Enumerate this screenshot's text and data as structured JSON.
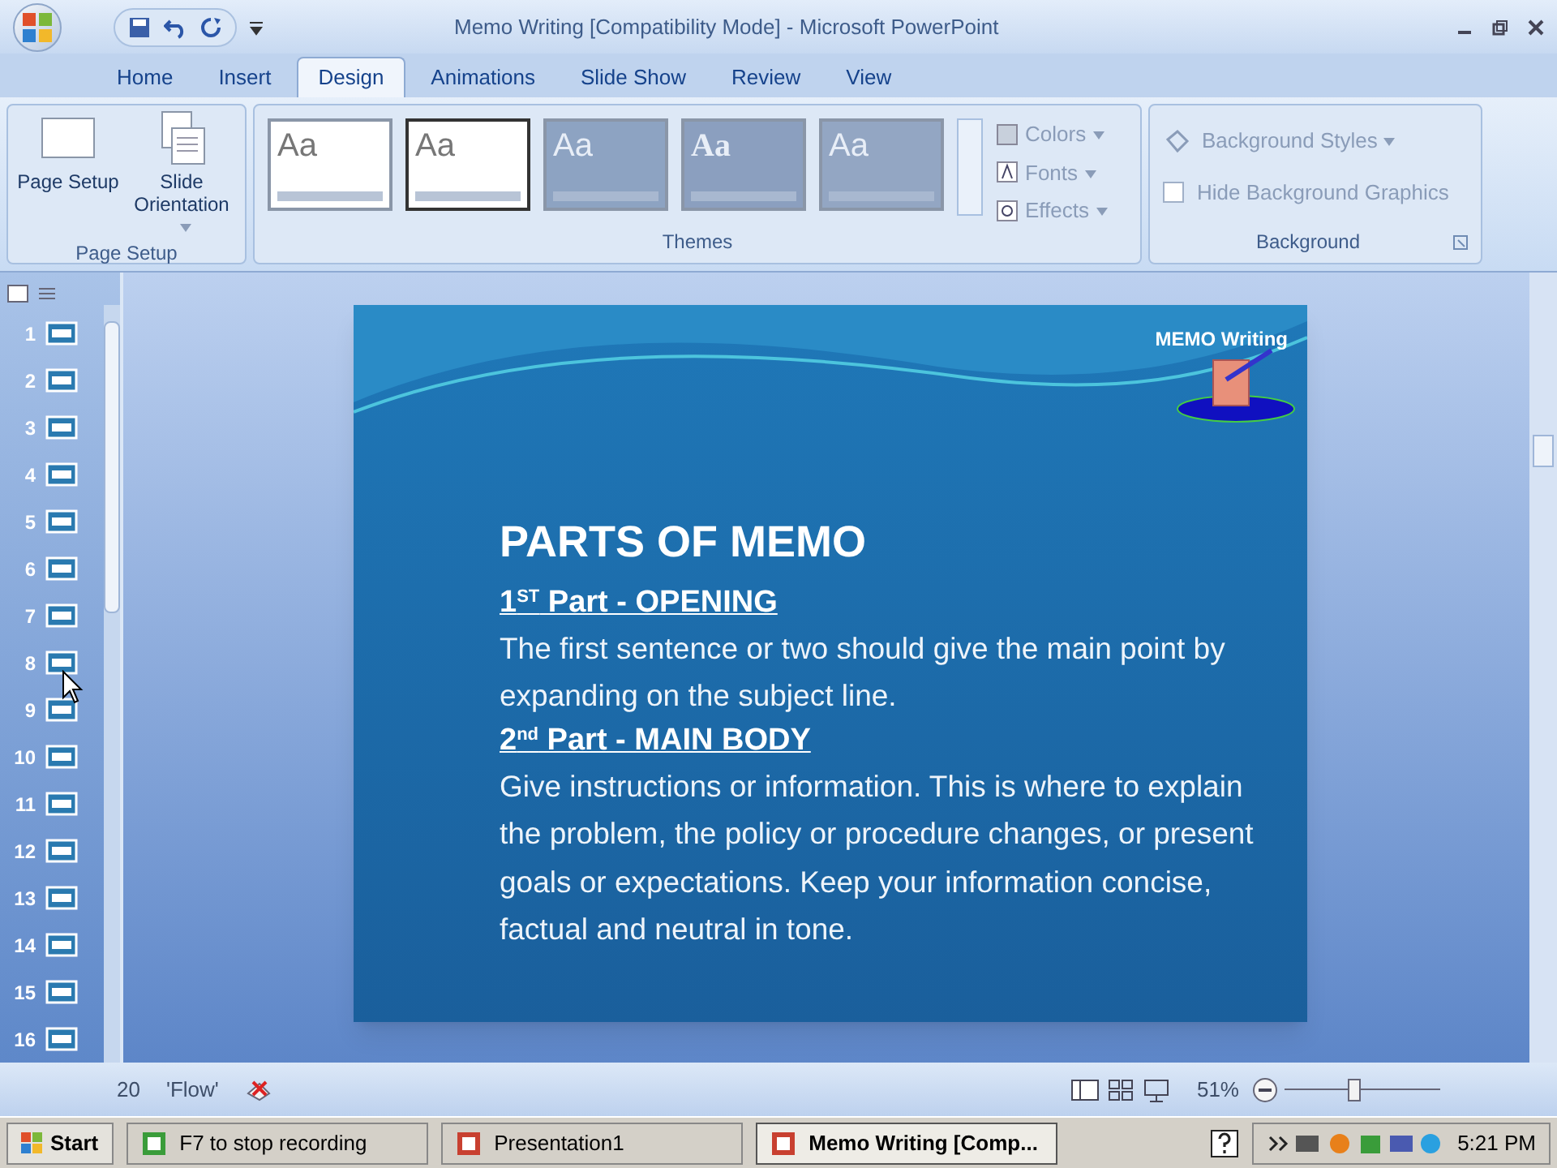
{
  "window": {
    "title": "Memo Writing [Compatibility Mode] - Microsoft PowerPoint"
  },
  "tabs": [
    {
      "label": "Home",
      "selected": false
    },
    {
      "label": "Insert",
      "selected": false
    },
    {
      "label": "Design",
      "selected": true
    },
    {
      "label": "Animations",
      "selected": false
    },
    {
      "label": "Slide Show",
      "selected": false
    },
    {
      "label": "Review",
      "selected": false
    },
    {
      "label": "View",
      "selected": false
    }
  ],
  "ribbon": {
    "page_setup": {
      "buttons": [
        "Page Setup",
        "Slide Orientation"
      ],
      "label": "Page Setup"
    },
    "themes": {
      "items": [
        {
          "label": "Aa",
          "selected": false
        },
        {
          "label": "Aa",
          "selected": true
        },
        {
          "label": "Aa",
          "selected": false
        },
        {
          "label": "Aa",
          "selected": false
        },
        {
          "label": "Aa",
          "selected": false
        }
      ],
      "options": [
        "Colors",
        "Fonts",
        "Effects"
      ],
      "label": "Themes"
    },
    "background": {
      "styles": "Background Styles",
      "hide_graphics": {
        "label": "Hide Background Graphics",
        "checked": false
      },
      "label": "Background"
    }
  },
  "slides_pane": {
    "numbers": [
      "1",
      "2",
      "3",
      "4",
      "5",
      "6",
      "7",
      "8",
      "9",
      "10",
      "11",
      "12",
      "13",
      "14",
      "15",
      "16"
    ]
  },
  "slide": {
    "header": "MEMO Writing",
    "title": "PARTS OF MEMO",
    "paragraphs": [
      {
        "kind": "heading",
        "text": "1$^{ST}$ Part - OPENING"
      },
      {
        "kind": "body",
        "text": "The first sentence or two should give the main point by expanding on the subject line."
      },
      {
        "kind": "heading",
        "text": "2$^{nd}$ Part - MAIN BODY"
      },
      {
        "kind": "body",
        "text": "Give instructions or information. This is where to explain the problem, the policy or procedure changes, or present goals or expectations. Keep your information concise, factual and neutral in tone."
      }
    ]
  },
  "status_bar": {
    "slide_count": "20",
    "theme": "'Flow'",
    "zoom": "51%",
    "zoom_slider": {
      "level": 0.45
    }
  },
  "taskbar": {
    "start": "Start",
    "tasks": [
      {
        "label": "F7 to stop recording",
        "selected": false
      },
      {
        "label": "Presentation1",
        "selected": false
      },
      {
        "label": "Memo Writing [Comp...",
        "selected": true
      }
    ],
    "clock": "5:21 PM"
  }
}
